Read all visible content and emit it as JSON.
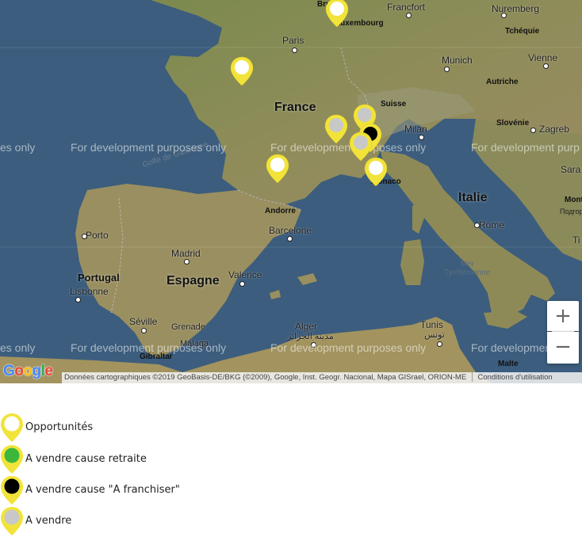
{
  "map": {
    "watermark": "For development purposes only",
    "watermark_partial": "es only",
    "watermark_cut": "For development purp",
    "watermark_cut2": "For development",
    "zoom_in": "+",
    "zoom_out": "−",
    "attribution": "Données cartographiques ©2019 GeoBasis-DE/BKG (©2009), Google, Inst. Geogr. Nacional, Mapa GISrael, ORION-ME",
    "terms": "Conditions d'utilisation",
    "logo": [
      "G",
      "o",
      "o",
      "g",
      "l",
      "e"
    ],
    "logo_colors": [
      "#4285F4",
      "#EA4335",
      "#FBBC05",
      "#4285F4",
      "#34A853",
      "#EA4335"
    ],
    "countries": {
      "france": "France",
      "espagne": "Espagne",
      "italie": "Italie",
      "portugal": "Portugal",
      "suisse": "Suisse",
      "autriche": "Autriche",
      "tchequie": "Tchéquie",
      "slovenie": "Slovénie",
      "andorre": "Andorre",
      "monaco": "Monaco",
      "luxembourg": "Luxembourg",
      "malte": "Malte"
    },
    "cities": {
      "paris": "Paris",
      "frankfort": "Francfort",
      "nuremberg": "Nuremberg",
      "munich": "Munich",
      "vienne": "Vienne",
      "milan": "Milan",
      "zagreb": "Zagreb",
      "barcelone": "Barcelone",
      "madrid": "Madrid",
      "porto": "Porto",
      "lisbonne": "Lisbonne",
      "valence": "Valence",
      "seville": "Séville",
      "grenade": "Grenade",
      "malaga": "Málaga",
      "gibraltar": "Gibraltar",
      "alger": "Alger",
      "alger_ar": "مدينة الجزائر",
      "tunis": "Tunis",
      "tunis_ar": "تونس",
      "rome": "Rome",
      "sara": "Sara",
      "mont": "Mont",
      "podgorica": "Подгори",
      "ti": "Ti",
      "bruxelles": "Bru"
    },
    "seas": {
      "tyrrhenienne": [
        "Mer",
        "Tyrrhénienne"
      ],
      "gascogne": "Golfe de Gascogne"
    },
    "markers": [
      {
        "type": "opportunites",
        "center": "#ffffff"
      },
      {
        "type": "opportunites",
        "center": "#ffffff"
      },
      {
        "type": "a_vendre",
        "center": "#c8c8c8"
      },
      {
        "type": "a_vendre",
        "center": "#c8c8c8"
      },
      {
        "type": "a_franchiser",
        "center": "#000000"
      },
      {
        "type": "a_vendre",
        "center": "#c8c8c8"
      },
      {
        "type": "opportunites",
        "center": "#ffffff"
      },
      {
        "type": "opportunites",
        "center": "#ffffff"
      }
    ],
    "colors": {
      "pin_yellow": "#f2e33a",
      "land": "#8a8a52",
      "water": "#3c5d7d"
    }
  },
  "legend": [
    {
      "label": "Opportunités",
      "icon": "pin-white-icon",
      "color": "#ffffff"
    },
    {
      "label": "A vendre cause retraite",
      "icon": "pin-green-icon",
      "color": "#3cb73c"
    },
    {
      "label": "A vendre cause \"A franchiser\"",
      "icon": "pin-black-icon",
      "color": "#000000"
    },
    {
      "label": "A vendre",
      "icon": "pin-grey-icon",
      "color": "#c8c8c8"
    }
  ]
}
